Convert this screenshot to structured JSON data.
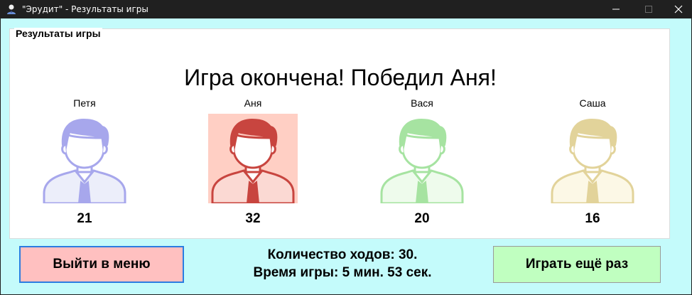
{
  "window": {
    "title": "\"Эрудит\" - Результаты игры",
    "icon": "user-icon",
    "controls": [
      "minimize-icon",
      "maximize-icon",
      "close-icon"
    ]
  },
  "group": {
    "legend": "Результаты игры"
  },
  "headline": "Игра окончена! Победил Аня!",
  "players": [
    {
      "name": "Петя",
      "score": "21",
      "highlighted": false,
      "color": "#a7a7ec",
      "fill": "#eceefa",
      "bg": ""
    },
    {
      "name": "Аня",
      "score": "32",
      "highlighted": true,
      "color": "#c8453f",
      "fill": "#fbd9d3",
      "bg": "#ffcfc4"
    },
    {
      "name": "Вася",
      "score": "20",
      "highlighted": false,
      "color": "#a6e3a1",
      "fill": "#eefbec",
      "bg": ""
    },
    {
      "name": "Саша",
      "score": "16",
      "highlighted": false,
      "color": "#e2d39a",
      "fill": "#fcf8e6",
      "bg": ""
    }
  ],
  "stats": {
    "moves": "Количество ходов: 30.",
    "time": "Время игры: 5 мин. 53 сек."
  },
  "buttons": {
    "exit_label": "Выйти в меню",
    "again_label": "Играть ещё раз"
  },
  "colors": {
    "window_bg": "#c4fbfb",
    "exit_button": "#ffc0c0",
    "again_button": "#c0ffc0",
    "exit_focus_border": "#2a7de1"
  }
}
